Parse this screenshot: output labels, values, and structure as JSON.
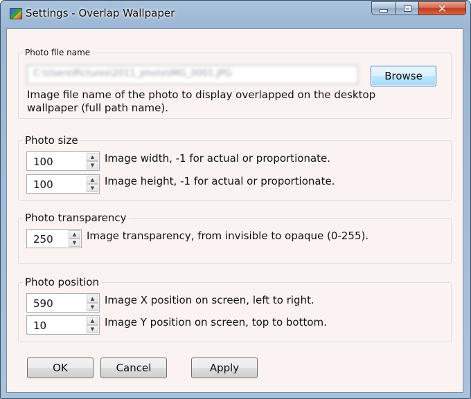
{
  "window": {
    "title": "Settings - Overlap Wallpaper",
    "icon": "app-icon",
    "controls": {
      "minimize_icon": "minimize-icon",
      "maximize_icon": "maximize-icon",
      "close_glyph": "✕"
    }
  },
  "photo_file": {
    "legend": "Photo file name",
    "value": "C:\\Users\\Pictures\\2011_photo\\IMG_0001.JPG",
    "browse_label": "Browse",
    "description": "Image file name of the photo to display overlapped on the desktop wallpaper (full path name)."
  },
  "photo_size": {
    "legend": "Photo size",
    "width_value": "100",
    "width_desc": "Image width, -1 for actual or proportionate.",
    "height_value": "100",
    "height_desc": "Image height, -1 for actual or proportionate."
  },
  "photo_transparency": {
    "legend": "Photo transparency",
    "value": "250",
    "desc": "Image transparency, from invisible to opaque (0-255)."
  },
  "photo_position": {
    "legend": "Photo position",
    "x_value": "590",
    "x_desc": "Image X position on screen, left to right.",
    "y_value": "10",
    "y_desc": "Image Y position on screen, top to bottom."
  },
  "buttons": {
    "ok": "OK",
    "cancel": "Cancel",
    "apply": "Apply"
  },
  "spinner": {
    "up_glyph": "▲",
    "down_glyph": "▼"
  }
}
